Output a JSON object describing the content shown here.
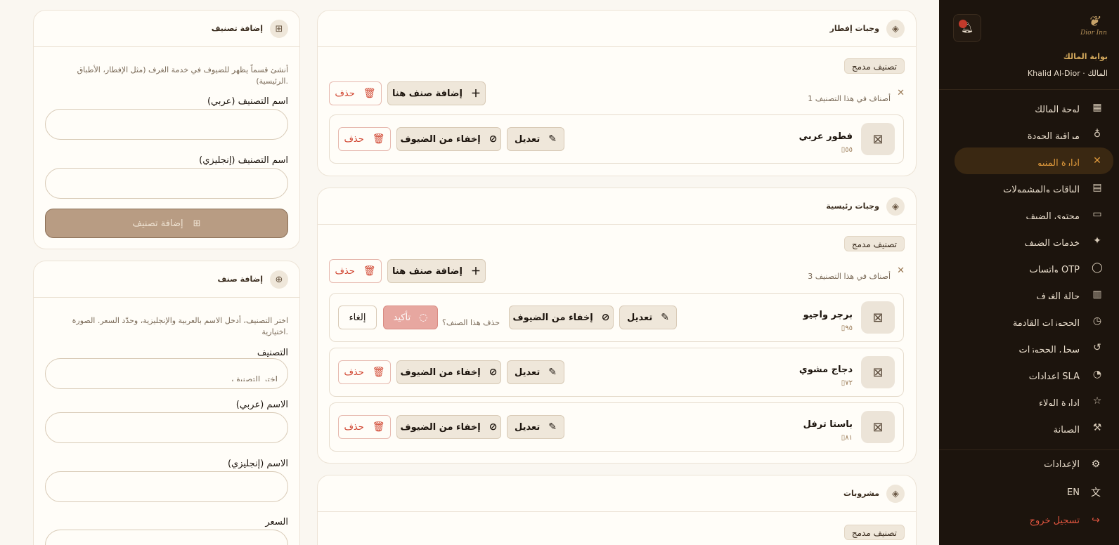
{
  "sidebar": {
    "logo_text": "Dior Inn",
    "portal_label": "بوابة المالك",
    "user_line": "Khalid Al-Dior · المالك",
    "nav": [
      {
        "label": "لوحة المالك",
        "icon": "dashboard-icon",
        "glyph": "▦"
      },
      {
        "label": "مراقبة الجودة",
        "icon": "award-icon",
        "glyph": "♁"
      },
      {
        "label": "إدارة المنيو",
        "icon": "utensils-icon",
        "glyph": "✕",
        "active": true
      },
      {
        "label": "الباقات والمشمولات",
        "icon": "gift-icon",
        "glyph": "▤"
      },
      {
        "label": "محتوى الضيف",
        "icon": "document-icon",
        "glyph": "▭"
      },
      {
        "label": "خدمات الضيف",
        "icon": "sparkles-icon",
        "glyph": "✦"
      },
      {
        "label": "واتساب OTP",
        "icon": "chat-icon",
        "glyph": "◯"
      },
      {
        "label": "حالة الغرف",
        "icon": "building-icon",
        "glyph": "▥"
      },
      {
        "label": "الحجوزات القادمة",
        "icon": "calendar-clock-icon",
        "glyph": "◷"
      },
      {
        "label": "سجل الحجوزات",
        "icon": "history-icon",
        "glyph": "↺"
      },
      {
        "label": "إعدادات SLA",
        "icon": "timer-icon",
        "glyph": "◔"
      },
      {
        "label": "إدارة الولاء",
        "icon": "star-icon",
        "glyph": "☆"
      },
      {
        "label": "الصيانة",
        "icon": "wrench-icon",
        "glyph": "⚒"
      }
    ],
    "settings_label": "الإعدادات",
    "language_label": "EN",
    "logout_label": "تسجيل خروج"
  },
  "categories": [
    {
      "title": "وجبات إفطار",
      "badge": "تصنيف مدمج",
      "count_text": "1 أصناف في هذا التصنيف",
      "add_label": "إضافة صنف هنا",
      "delete_label": "حذف",
      "items": [
        {
          "name": "فطور عربي",
          "price": "٥٥"
        }
      ]
    },
    {
      "title": "وجبات رئيسية",
      "badge": "تصنيف مدمج",
      "count_text": "3 أصناف في هذا التصنيف",
      "add_label": "إضافة صنف هنا",
      "delete_label": "حذف",
      "items": [
        {
          "name": "برجر واجيو",
          "price": "٩٥",
          "confirm_question": "حذف هذا الصنف؟",
          "confirm_label": "تأكيد",
          "cancel_label": "إلغاء"
        },
        {
          "name": "دجاج مشوي",
          "price": "٧٢"
        },
        {
          "name": "باستا ترفل",
          "price": "٨١"
        }
      ]
    },
    {
      "title": "مشروبات",
      "badge": "تصنيف مدمج"
    }
  ],
  "item_actions": {
    "edit": "تعديل",
    "hide": "إخفاء من الضيوف",
    "delete": "حذف"
  },
  "add_category": {
    "title": "إضافة تصنيف",
    "description": "أنشئ قسماً يظهر للضيوف في خدمة الغرف (مثل الإفطار، الأطباق الرئيسية).",
    "name_ar_label": "اسم التصنيف (عربي)",
    "name_en_label": "اسم التصنيف (إنجليزي)",
    "submit_label": "إضافة تصنيف"
  },
  "add_item": {
    "title": "إضافة صنف",
    "description": "اختر التصنيف، أدخل الاسم بالعربية والإنجليزية، وحدّد السعر. الصورة اختيارية.",
    "category_label": "التصنيف",
    "category_placeholder": "اختر التصنيف",
    "name_ar_label": "الاسم (عربي)",
    "name_en_label": "الاسم (إنجليزي)",
    "price_label": "السعر"
  },
  "colors": {
    "accent": "#e09a3c",
    "sidebar_bg": "#1c140d",
    "danger": "#d0442f",
    "page_bg": "#faf7f1"
  }
}
